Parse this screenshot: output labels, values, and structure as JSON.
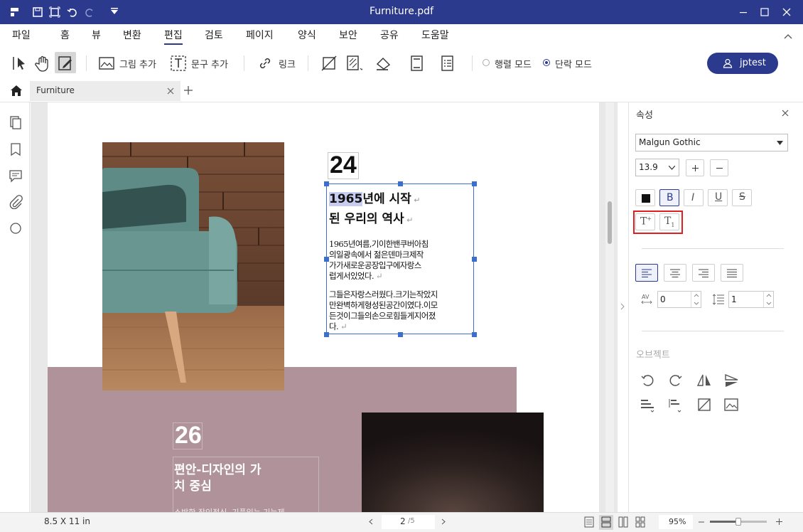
{
  "window": {
    "title": "Furniture.pdf"
  },
  "menu": [
    "파일",
    "홈",
    "뷰",
    "변환",
    "편집",
    "검토",
    "페이지",
    "양식",
    "보안",
    "공유",
    "도움말"
  ],
  "toolbar": {
    "add_image": "그림 추가",
    "add_text": "문구 추가",
    "link": "링크",
    "line_mode": "행렬 모드",
    "paragraph_mode": "단락 모드"
  },
  "user": {
    "name": "jptest"
  },
  "tab": {
    "name": "Furniture"
  },
  "page": {
    "section1": {
      "number": "24",
      "heading_highlight": "1965",
      "heading_rest1": "년에 시작",
      "heading_line2": "된 우리의 역사",
      "para1": [
        "1965년여름,기이한밴쿠버아침",
        "의일광속에서 젊은덴마크제작",
        "가가새로운공장입구에자랑스",
        "럽게서있었다."
      ],
      "para2": [
        "그들은자랑스러웠다.크기는작았지",
        "만완벽하게형성된공간이였다.이모",
        "든것이그들의손으로힘들게지어졌",
        "다."
      ]
    },
    "section2": {
      "number": "26",
      "heading_line1": "편안-디자인의 가",
      "heading_line2": "치 중심",
      "body_partial": "소박한 장인정신, 기품있는 기능제"
    }
  },
  "properties": {
    "title": "속성",
    "font": "Malgun Gothic",
    "size": "13.9",
    "char_spacing": "0",
    "line_spacing": "1",
    "object_title": "오브젝트"
  },
  "status": {
    "page_size": "8.5 X 11 in",
    "current_page": "2",
    "total_pages": "/5",
    "zoom": "95%"
  },
  "colors": {
    "accent": "#2b3a8c",
    "pink_block": "#b0939a",
    "highlight": "#c8cdf0",
    "selection_red": "#e02020"
  }
}
